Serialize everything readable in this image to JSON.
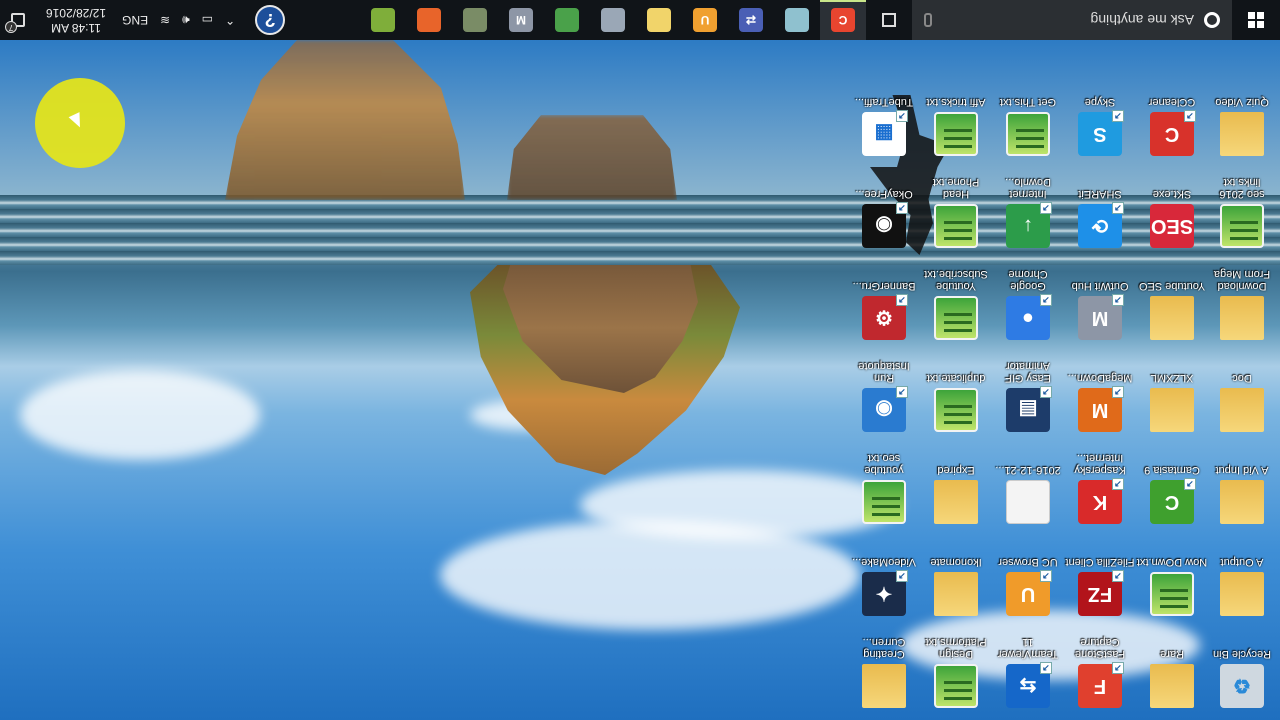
{
  "screen": {
    "orientation": "rotated-180"
  },
  "taskbar": {
    "start_label": "Start",
    "search_placeholder": "Ask me anything",
    "pinned_apps": [
      {
        "name": "Camtasia",
        "icon": "camtasia-icon",
        "color": "#e8452f",
        "glyph": "C",
        "active": true
      },
      {
        "name": "Notepad",
        "icon": "notepad-icon",
        "color": "#8fc1cf",
        "glyph": ""
      },
      {
        "name": "Network Connections",
        "icon": "network-icon",
        "color": "#4a5fb5",
        "glyph": "⇄"
      },
      {
        "name": "UC Browser",
        "icon": "uc-browser-icon",
        "color": "#f0a030",
        "glyph": "U"
      },
      {
        "name": "File Explorer",
        "icon": "folder-icon",
        "color": "#f1d46a",
        "glyph": ""
      },
      {
        "name": "Control Panel",
        "icon": "control-panel-icon",
        "color": "#9aa7b6",
        "glyph": ""
      },
      {
        "name": "Image Viewer",
        "icon": "image-viewer-icon",
        "color": "#4aa14a",
        "glyph": ""
      },
      {
        "name": "OutWit Hub",
        "icon": "outwit-icon",
        "color": "#8d96a6",
        "glyph": "M"
      },
      {
        "name": "Paint",
        "icon": "paint-icon",
        "color": "#7a8c66",
        "glyph": ""
      },
      {
        "name": "Firefox",
        "icon": "firefox-icon",
        "color": "#e8642a",
        "glyph": ""
      },
      {
        "name": "Android",
        "icon": "android-icon",
        "color": "#7fae3a",
        "glyph": ""
      }
    ],
    "tray": {
      "help_label": "?",
      "language": "ENG",
      "time": "11:48 AM",
      "date": "12/28/2016",
      "notification_count": "7"
    }
  },
  "desktop": {
    "columns": [
      {
        "icons": [
          {
            "label": "Recycle Bin",
            "type": "recycle",
            "color": "#cfd8e0",
            "glyph": "♻"
          },
          {
            "label": "A Output",
            "type": "folder"
          },
          {
            "label": "A Vid Input",
            "type": "folder"
          },
          {
            "label": "Doc",
            "type": "folder"
          },
          {
            "label": "Download From Mega",
            "type": "folder"
          },
          {
            "label": "seo 2016 links.txt",
            "type": "txt"
          },
          {
            "label": "Quiz Video",
            "type": "folder"
          }
        ]
      },
      {
        "icons": [
          {
            "label": "Rare",
            "type": "folder"
          },
          {
            "label": "Now DOwn.txt",
            "type": "txt"
          },
          {
            "label": "Camtasia 9",
            "type": "app",
            "color": "#3fa02e",
            "glyph": "C",
            "shortcut": true
          },
          {
            "label": "XLZXML",
            "type": "folder"
          },
          {
            "label": "Youtube SEO",
            "type": "folder"
          },
          {
            "label": "SKt.exe",
            "type": "app",
            "color": "#d8283a",
            "glyph": "SEO"
          },
          {
            "label": "CCleaner",
            "type": "app",
            "color": "#d8322b",
            "glyph": "C",
            "shortcut": true
          }
        ]
      },
      {
        "icons": [
          {
            "label": "FastStone Capture",
            "type": "app",
            "color": "#e0402e",
            "glyph": "F",
            "shortcut": true
          },
          {
            "label": "FileZilla Client",
            "type": "app",
            "color": "#b2141b",
            "glyph": "FZ",
            "shortcut": true
          },
          {
            "label": "Kaspersky Internet...",
            "type": "app",
            "color": "#d92a2a",
            "glyph": "K",
            "shortcut": true
          },
          {
            "label": "MegaDown...",
            "type": "app",
            "color": "#e06a1a",
            "glyph": "M",
            "shortcut": true
          },
          {
            "label": "OutWit Hub",
            "type": "app",
            "color": "#8d96a6",
            "glyph": "M",
            "shortcut": true
          },
          {
            "label": "SHAREit",
            "type": "app",
            "color": "#1e90e8",
            "glyph": "⟳",
            "shortcut": true
          },
          {
            "label": "Skype",
            "type": "app",
            "color": "#1f9be0",
            "glyph": "S",
            "shortcut": true
          }
        ]
      },
      {
        "icons": [
          {
            "label": "TeamViewer 11",
            "type": "app",
            "color": "#1567c9",
            "glyph": "⇆",
            "shortcut": true
          },
          {
            "label": "UC Browser",
            "type": "app",
            "color": "#f09b2a",
            "glyph": "U",
            "shortcut": true
          },
          {
            "label": "2016-12-21...",
            "type": "doc",
            "color": "#f4f4f4",
            "glyph": ""
          },
          {
            "label": "Easy GIF Animator",
            "type": "app",
            "color": "#1d3c6a",
            "glyph": "▤",
            "shortcut": true
          },
          {
            "label": "Google Chrome",
            "type": "app",
            "color": "#2e7be4",
            "glyph": "●",
            "shortcut": true
          },
          {
            "label": "Internet Downlo...",
            "type": "app",
            "color": "#2c9c4a",
            "glyph": "↓",
            "shortcut": true
          },
          {
            "label": "Get This.txt",
            "type": "txt"
          }
        ]
      },
      {
        "icons": [
          {
            "label": "Design Platforms.txt",
            "type": "txt"
          },
          {
            "label": "Ikonomate",
            "type": "folder"
          },
          {
            "label": "Expired",
            "type": "folder"
          },
          {
            "label": "duplicate.txt",
            "type": "txt"
          },
          {
            "label": "Youtube Subscribe.txt",
            "type": "txt"
          },
          {
            "label": "Head Phone.txt",
            "type": "txt"
          },
          {
            "label": "Affi tricks.txt",
            "type": "txt"
          }
        ]
      },
      {
        "icons": [
          {
            "label": "Creating Curren...",
            "type": "folder"
          },
          {
            "label": "VideoMake...",
            "type": "app",
            "color": "#1a2c4a",
            "glyph": "✦",
            "shortcut": true
          },
          {
            "label": "youtube seo.txt",
            "type": "txt"
          },
          {
            "label": "Run Instaquote",
            "type": "app",
            "color": "#2a7bd0",
            "glyph": "◉",
            "shortcut": true
          },
          {
            "label": "BannerGru...",
            "type": "app",
            "color": "#c0282e",
            "glyph": "⚙",
            "shortcut": true
          },
          {
            "label": "OkayFree...",
            "type": "app",
            "color": "#111111",
            "glyph": "◉",
            "shortcut": true
          },
          {
            "label": "TubeTraffi...",
            "type": "app",
            "color": "#ffffff",
            "glyph": "▦",
            "shortcut": true
          }
        ]
      }
    ]
  }
}
